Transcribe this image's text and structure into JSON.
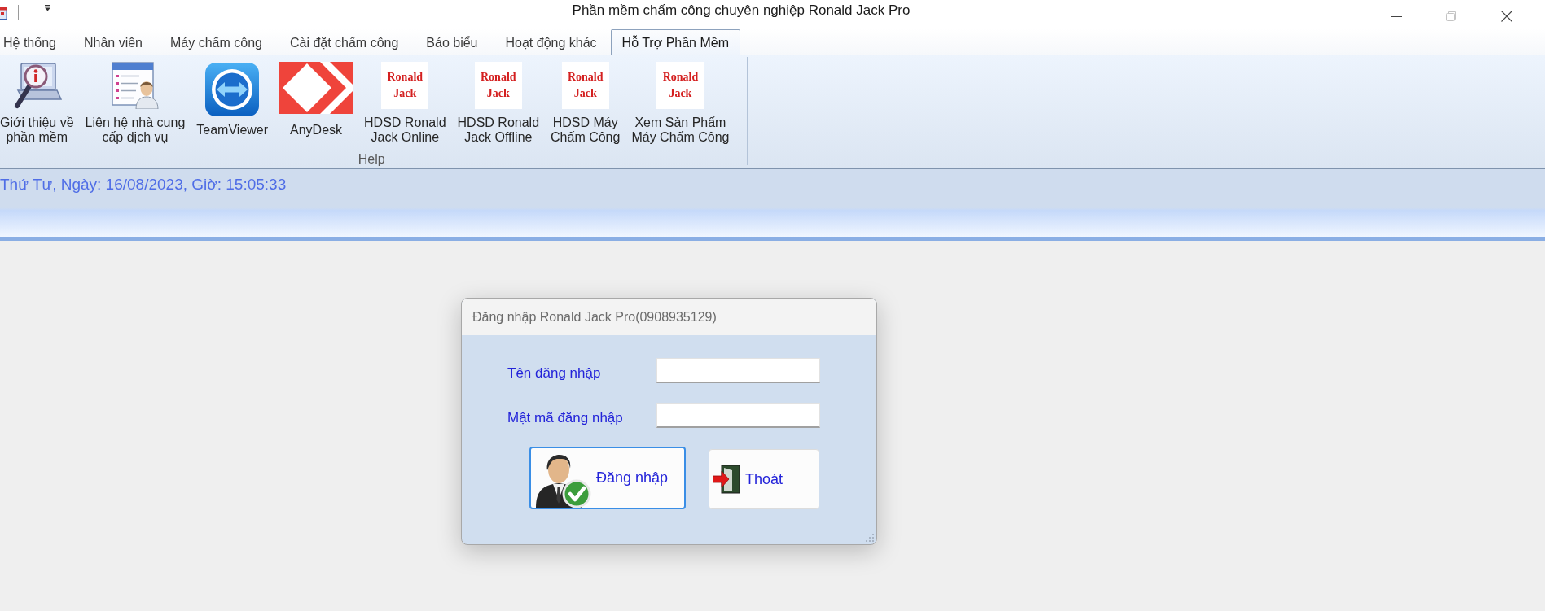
{
  "window": {
    "title": "Phần mềm chấm công chuyên nghiệp Ronald Jack Pro",
    "controls": [
      {
        "kind": "minimize",
        "disabled": false
      },
      {
        "kind": "restore",
        "disabled": true
      },
      {
        "kind": "close",
        "disabled": false
      }
    ]
  },
  "tabs": [
    {
      "label": "Hệ thống",
      "selected": false
    },
    {
      "label": "Nhân viên",
      "selected": false
    },
    {
      "label": "Máy chấm công",
      "selected": false
    },
    {
      "label": "Cài đặt chấm công",
      "selected": false
    },
    {
      "label": "Báo biểu",
      "selected": false
    },
    {
      "label": "Hoạt động khác",
      "selected": false
    },
    {
      "label": "Hỗ Trợ Phần Mềm",
      "selected": true
    }
  ],
  "ribbon": {
    "groups": [
      {
        "label": "Help",
        "items": [
          {
            "kind": "info",
            "lines": [
              "Giới thiệu về",
              "phần mềm"
            ]
          },
          {
            "kind": "contact",
            "lines": [
              "Liên hệ nhà cung",
              "cấp dịch vụ"
            ]
          },
          {
            "kind": "remote",
            "lines": [
              "TeamViewer"
            ]
          },
          {
            "kind": "desk",
            "lines": [
              "AnyDesk"
            ]
          },
          {
            "kind": "logo",
            "logo": [
              "Ronald",
              "Jack"
            ],
            "lines": [
              "HDSD Ronald",
              "Jack Online"
            ]
          },
          {
            "kind": "logo",
            "logo": [
              "Ronald",
              "Jack"
            ],
            "lines": [
              "HDSD Ronald",
              "Jack Offline"
            ]
          },
          {
            "kind": "logo",
            "logo": [
              "Ronald",
              "Jack"
            ],
            "lines": [
              "HDSD Máy",
              "Chấm Công"
            ]
          },
          {
            "kind": "logo",
            "logo": [
              "Ronald",
              "Jack"
            ],
            "lines": [
              "Xem Sản Phẩm",
              "Máy Chấm Công"
            ]
          }
        ]
      }
    ]
  },
  "date_bar": {
    "text": "Thứ Tư, Ngày: 16/08/2023, Giờ: 15:05:33"
  },
  "login_dialog": {
    "title": "Đăng nhập Ronald Jack Pro(0908935129)",
    "fields": [
      {
        "label": "Tên đăng nhập"
      },
      {
        "label": "Mật mã đăng nhập"
      }
    ],
    "buttons": [
      {
        "kind": "login",
        "label": "Đăng nhập",
        "focused": true
      },
      {
        "kind": "exit",
        "label": "Thoát",
        "focused": false
      }
    ]
  }
}
